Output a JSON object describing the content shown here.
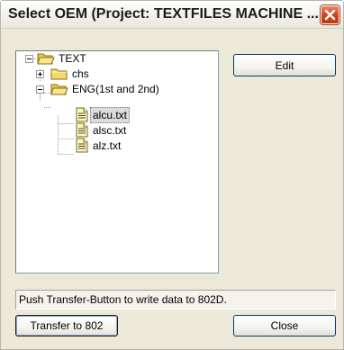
{
  "window": {
    "title": "Select OEM (Project: TEXTFILES MACHINE ..."
  },
  "tree": {
    "root": {
      "label": "TEXT",
      "expanded": true
    },
    "items": [
      {
        "label": "chs",
        "expanded": false
      },
      {
        "label": "ENG(1st and 2nd)",
        "expanded": true,
        "files": [
          "alcu.txt",
          "alsc.txt",
          "alz.txt"
        ],
        "selected_file": "alcu.txt"
      }
    ]
  },
  "buttons": {
    "edit": "Edit",
    "transfer": "Transfer to 802",
    "close": "Close"
  },
  "status": {
    "message": "Push Transfer-Button to write data to 802D."
  },
  "icons": {
    "close": "close-x-icon",
    "folder": "folder-icon",
    "folder_open": "folder-open-icon",
    "file": "text-file-icon",
    "expand": "plus-expander-icon",
    "collapse": "minus-expander-icon"
  },
  "colors": {
    "dialog_bg": "#ece9d8",
    "close_button": "#d2451c",
    "folder": "#f5d76e",
    "tree_border": "#7f9db9"
  }
}
